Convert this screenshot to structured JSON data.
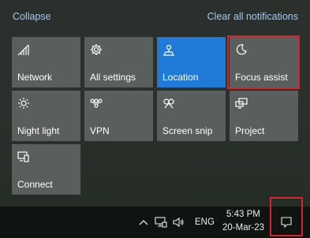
{
  "action_center": {
    "collapse_label": "Collapse",
    "clear_label": "Clear all notifications",
    "accent_color": "#1f7ad8",
    "highlight_color": "#d8242c",
    "tiles": [
      {
        "label": "Network",
        "icon": "network-icon",
        "active": false
      },
      {
        "label": "All settings",
        "icon": "gear-icon",
        "active": false
      },
      {
        "label": "Location",
        "icon": "location-icon",
        "active": true
      },
      {
        "label": "Focus assist",
        "icon": "moon-icon",
        "active": false,
        "highlighted": true
      },
      {
        "label": "Night light",
        "icon": "brightness-icon",
        "active": false
      },
      {
        "label": "VPN",
        "icon": "vpn-icon",
        "active": false
      },
      {
        "label": "Screen snip",
        "icon": "screen-snip-icon",
        "active": false
      },
      {
        "label": "Project",
        "icon": "project-icon",
        "active": false
      },
      {
        "label": "Connect",
        "icon": "connect-icon",
        "active": false
      }
    ]
  },
  "taskbar": {
    "language": "ENG",
    "time": "5:43 PM",
    "date": "20-Mar-23",
    "tray_icons": [
      "chevron-up-icon",
      "network-icon",
      "volume-icon"
    ],
    "action_center_button": {
      "icon": "notification-icon",
      "highlighted": true
    }
  }
}
